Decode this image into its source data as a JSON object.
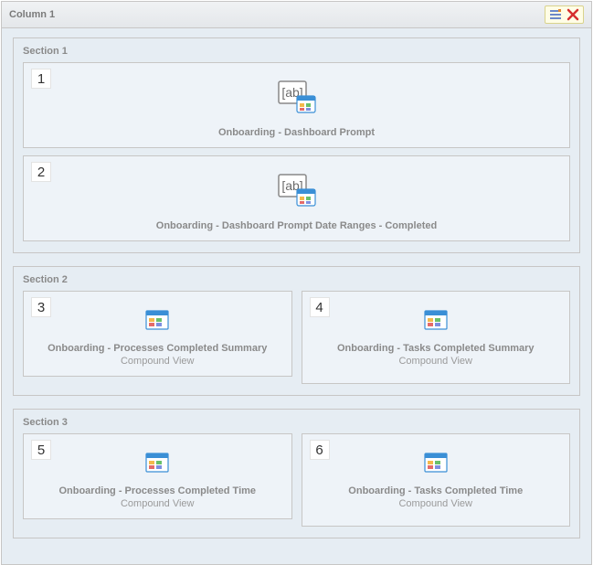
{
  "column": {
    "title": "Column 1"
  },
  "sections": [
    {
      "label": "Section 1",
      "items": [
        {
          "num": "1",
          "title": "Onboarding - Dashboard Prompt",
          "sub": "",
          "iconType": "prompt"
        },
        {
          "num": "2",
          "title": "Onboarding - Dashboard Prompt Date Ranges - Completed",
          "sub": "",
          "iconType": "prompt"
        }
      ]
    },
    {
      "label": "Section 2",
      "items": [
        {
          "num": "3",
          "title": "Onboarding - Processes Completed Summary",
          "sub": "Compound View",
          "iconType": "analysis"
        },
        {
          "num": "4",
          "title": "Onboarding - Tasks Completed Summary",
          "sub": "Compound View",
          "iconType": "analysis"
        }
      ]
    },
    {
      "label": "Section 3",
      "items": [
        {
          "num": "5",
          "title": "Onboarding - Processes Completed Time",
          "sub": "Compound View",
          "iconType": "analysis"
        },
        {
          "num": "6",
          "title": "Onboarding - Tasks Completed Time",
          "sub": "Compound View",
          "iconType": "analysis"
        }
      ]
    }
  ]
}
